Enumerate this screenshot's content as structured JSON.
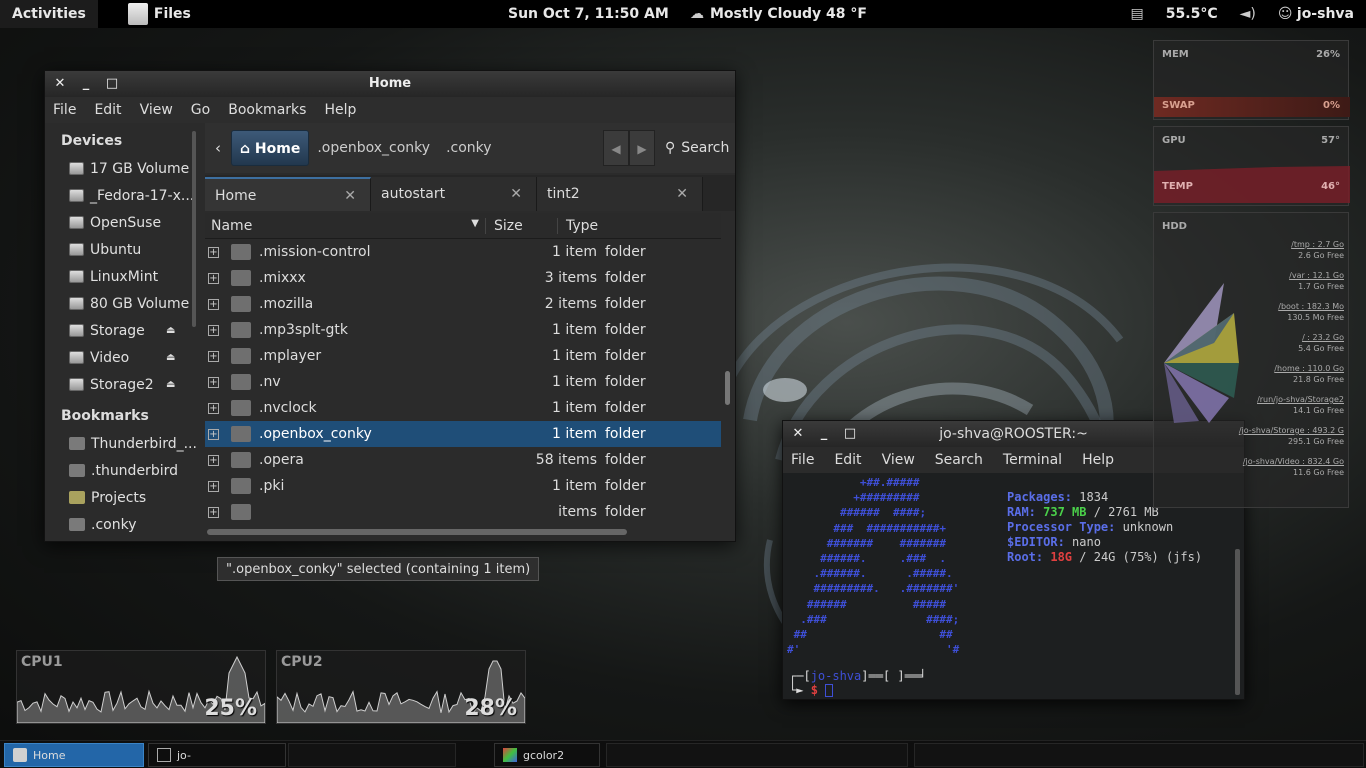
{
  "topbar": {
    "activities": "Activities",
    "app_name": "Files",
    "clock": "Sun Oct  7, 11:50 AM",
    "weather": "Mostly Cloudy 48 °F",
    "temperature": "55.5°C",
    "user": "jo-shva"
  },
  "file_manager": {
    "title": "Home",
    "menu": [
      "File",
      "Edit",
      "View",
      "Go",
      "Bookmarks",
      "Help"
    ],
    "sidebar": {
      "devices_header": "Devices",
      "devices": [
        "17 GB Volume",
        "_Fedora-17-x...",
        "OpenSuse",
        "Ubuntu",
        "LinuxMint",
        "80 GB Volume",
        "Storage",
        "Video",
        "Storage2"
      ],
      "bookmarks_header": "Bookmarks",
      "bookmarks": [
        "Thunderbird_...",
        ".thunderbird",
        "Projects",
        ".conky"
      ]
    },
    "pathbar": {
      "home": "Home",
      "crumb1": ".openbox_conky",
      "crumb2": ".conky",
      "search": "Search"
    },
    "tabs": [
      "Home",
      "autostart",
      "tint2"
    ],
    "columns": {
      "name": "Name",
      "size": "Size",
      "type": "Type"
    },
    "rows": [
      {
        "name": ".mission-control",
        "size": "1 item",
        "type": "folder"
      },
      {
        "name": ".mixxx",
        "size": "3 items",
        "type": "folder"
      },
      {
        "name": ".mozilla",
        "size": "2 items",
        "type": "folder"
      },
      {
        "name": ".mp3splt-gtk",
        "size": "1 item",
        "type": "folder"
      },
      {
        "name": ".mplayer",
        "size": "1 item",
        "type": "folder"
      },
      {
        "name": ".nv",
        "size": "1 item",
        "type": "folder"
      },
      {
        "name": ".nvclock",
        "size": "1 item",
        "type": "folder"
      },
      {
        "name": ".openbox_conky",
        "size": "1 item",
        "type": "folder"
      },
      {
        "name": ".opera",
        "size": "58 items",
        "type": "folder"
      },
      {
        "name": ".pki",
        "size": "1 item",
        "type": "folder"
      },
      {
        "name": "",
        "size": "items",
        "type": "folder"
      }
    ],
    "selected_row": 7,
    "status": "\".openbox_conky\" selected (containing 1 item)"
  },
  "terminal": {
    "title": "jo-shva@ROOSTER:~",
    "menu": [
      "File",
      "Edit",
      "View",
      "Search",
      "Terminal",
      "Help"
    ],
    "art": "           +##.#####\n          +#########\n        ######  ####;\n       ###  ###########+\n      #######    #######\n     ######.     .###  .\n    .######.      .#####.\n    #########.   .#######'\n   ######          #####\n  .###               ####;\n ##                    ##\n#'                      '#",
    "info": {
      "packages_label": "Packages:",
      "packages": "1834",
      "ram_label": "RAM:",
      "ram_used": "737 MB",
      "ram_total": "/ 2761 MB",
      "proc_label": "Processor Type:",
      "proc": "unknown",
      "editor_label": "$EDITOR:",
      "editor": "nano",
      "root_label": "Root:",
      "root_used": "18G",
      "root_rest": "/ 24G (75%) (jfs)"
    },
    "prompt_user": "jo-shva",
    "prompt_symbol": "$"
  },
  "conky": {
    "mem_label": "MEM",
    "mem": "26%",
    "swap_label": "SWAP",
    "swap": "0%",
    "gpu_label": "GPU",
    "gpu": "57°",
    "temp_label": "TEMP",
    "temp": "46°",
    "hdd_label": "HDD",
    "hdd": [
      {
        "mount": "/tmp : 2.7 Go",
        "free": "2.6 Go Free"
      },
      {
        "mount": "/var : 12.1 Go",
        "free": "1.7 Go Free"
      },
      {
        "mount": "/boot : 182.3 Mo",
        "free": "130.5 Mo Free"
      },
      {
        "mount": "/ : 23.2 Go",
        "free": "5.4 Go Free"
      },
      {
        "mount": "/home : 110.0 Go",
        "free": "21.8 Go Free"
      },
      {
        "mount": "/run/jo-shva/Storage2",
        "free": "14.1 Go Free"
      },
      {
        "mount": "/jo-shva/Storage : 493.2 G",
        "free": "295.1 Go Free"
      },
      {
        "mount": "/jo-shva/Video : 832.4 Go",
        "free": "11.6 Go Free"
      }
    ],
    "cpu1_label": "CPU1",
    "cpu1": "25%",
    "cpu2_label": "CPU2",
    "cpu2": "28%"
  },
  "taskbar": {
    "tasks": [
      "Home",
      "jo-shva@ROOSTER:~",
      "gcolor2"
    ]
  }
}
